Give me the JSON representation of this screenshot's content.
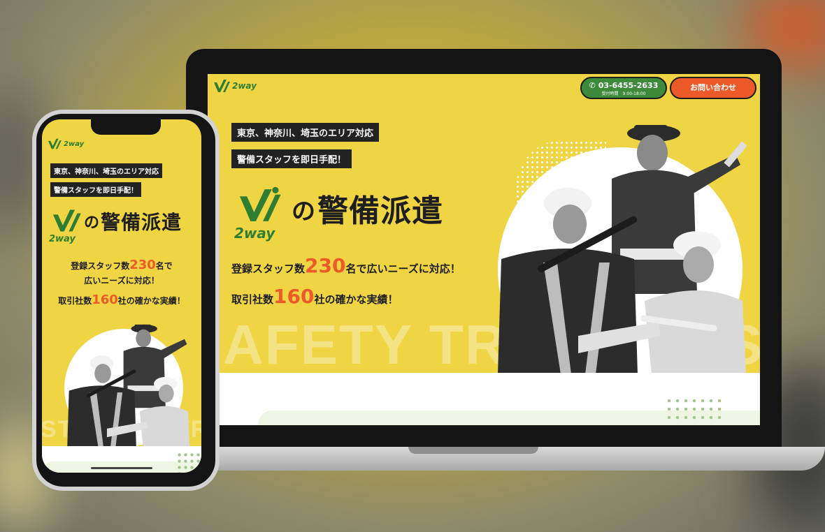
{
  "brand": {
    "name": "2way",
    "green": "#3d8a3a",
    "yellow": "#efd543",
    "orange": "#ec5a2a"
  },
  "header": {
    "phone": "03-6455-2633",
    "hours": "受付時間　9:00-18:00",
    "contact": "お問い合わせ"
  },
  "hero": {
    "tag1": "東京、神奈川、埼玉のエリア対応",
    "tag2": "警備スタッフを即日手配！",
    "title_particle": "の",
    "title_main": "警備派遣",
    "stat1_pre": "登録スタッフ数",
    "stat1_num": "230",
    "stat1_post": "名で広いニーズに対応！",
    "stat1_post_mobile": "名で",
    "stat1_line2_mobile": "広いニーズに対応！",
    "stat2_pre": "取引社数",
    "stat2_num": "160",
    "stat2_post": "社の確かな実績！",
    "watermark_desktop": "AFETY TRUS",
    "watermark_desktop_right": "SA",
    "watermark_mobile": "ST A",
    "watermark_mobile_right": "TRU"
  },
  "icons": [
    "phone-icon",
    "logo-icon",
    "guard-figure"
  ]
}
